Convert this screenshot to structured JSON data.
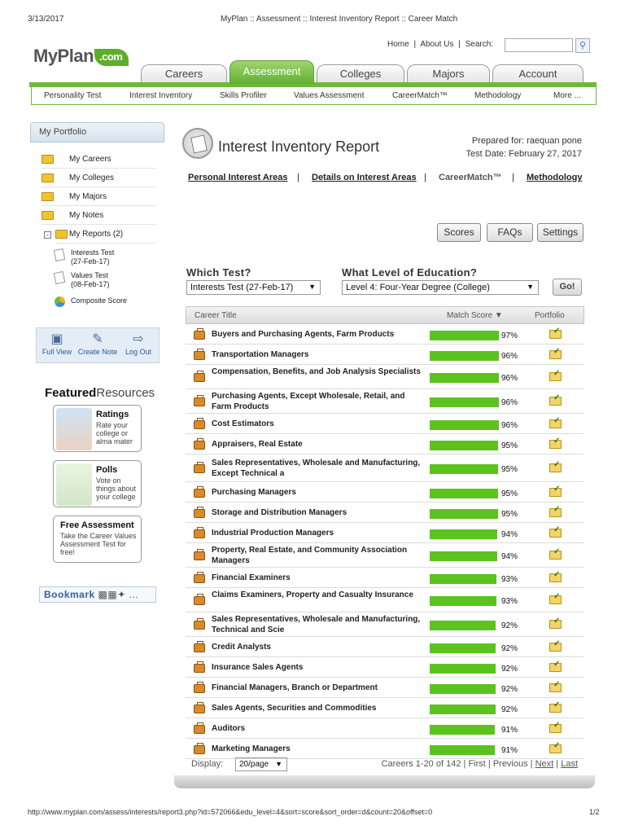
{
  "print": {
    "date": "3/13/2017",
    "title": "MyPlan :: Assessment :: Interest Inventory Report :: Career Match",
    "url": "http://www.myplan.com/assess/interests/report3.php?id=572066&edu_level=4&sort=score&sort_order=d&count=20&offset=0",
    "page": "1/2"
  },
  "header": {
    "logo_main": "MyPlan",
    "logo_com": ".com",
    "home": "Home",
    "about": "About Us",
    "search_label": "Search:",
    "search_value": "",
    "sep": "|"
  },
  "tabs": [
    "Careers",
    "Assessment",
    "Colleges",
    "Majors",
    "Account"
  ],
  "subnav": [
    "Personality Test",
    "Interest Inventory",
    "Skills Profiler",
    "Values Assessment",
    "CareerMatch™",
    "Methodology",
    "More ..."
  ],
  "sidebar": {
    "portfolio_title": "My Portfolio",
    "items": [
      "My Careers",
      "My Colleges",
      "My Majors",
      "My Notes",
      "My Reports (2)"
    ],
    "reports": [
      {
        "line1": "Interests Test",
        "line2": "(27-Feb-17)"
      },
      {
        "line1": "Values Test",
        "line2": "(08-Feb-17)"
      }
    ],
    "composite": "Composite Score",
    "tools": [
      "Full View",
      "Create Note",
      "Log Out"
    ],
    "featured_bold": "Featured",
    "featured_rest": "Resources",
    "resources": [
      {
        "title": "Ratings",
        "text": "Rate your college or alma mater"
      },
      {
        "title": "Polls",
        "text": "Vote on things about your college"
      },
      {
        "title": "Free Assessment",
        "text": "Take the Career Values Assessment Test for free!"
      }
    ],
    "bookmark": "Bookmark"
  },
  "report": {
    "title": "Interest Inventory Report",
    "prepared_for": "Prepared for: raequan pone",
    "test_date": "Test Date: February 27, 2017",
    "links": [
      "Personal Interest Areas",
      "Details on Interest Areas",
      "CareerMatch™",
      "Methodology"
    ],
    "buttons": [
      "Scores",
      "FAQs",
      "Settings"
    ],
    "which_test_label": "Which Test?",
    "which_test_value": "Interests Test (27-Feb-17)",
    "education_label": "What Level of Education?",
    "education_value": "Level 4: Four-Year Degree (College)",
    "go": "Go!"
  },
  "table": {
    "headers": {
      "title": "Career Title",
      "score": "Match Score ▼",
      "portfolio": "Portfolio"
    },
    "rows": [
      {
        "title": "Buyers and Purchasing Agents, Farm Products",
        "score": 97,
        "pct": "97%"
      },
      {
        "title": "Transportation Managers",
        "score": 96,
        "pct": "96%"
      },
      {
        "title": "Compensation, Benefits, and Job Analysis Specialists",
        "score": 96,
        "pct": "96%"
      },
      {
        "title": "Purchasing Agents, Except Wholesale, Retail, and Farm Products",
        "score": 96,
        "pct": "96%"
      },
      {
        "title": "Cost Estimators",
        "score": 96,
        "pct": "96%"
      },
      {
        "title": "Appraisers, Real Estate",
        "score": 95,
        "pct": "95%"
      },
      {
        "title": "Sales Representatives, Wholesale and Manufacturing, Except Technical a",
        "score": 95,
        "pct": "95%"
      },
      {
        "title": "Purchasing Managers",
        "score": 95,
        "pct": "95%"
      },
      {
        "title": "Storage and Distribution Managers",
        "score": 95,
        "pct": "95%"
      },
      {
        "title": "Industrial Production Managers",
        "score": 94,
        "pct": "94%"
      },
      {
        "title": "Property, Real Estate, and Community Association Managers",
        "score": 94,
        "pct": "94%"
      },
      {
        "title": "Financial Examiners",
        "score": 93,
        "pct": "93%"
      },
      {
        "title": "Claims Examiners, Property and Casualty Insurance",
        "score": 93,
        "pct": "93%"
      },
      {
        "title": "Sales Representatives, Wholesale and Manufacturing, Technical and Scie",
        "score": 92,
        "pct": "92%"
      },
      {
        "title": "Credit Analysts",
        "score": 92,
        "pct": "92%"
      },
      {
        "title": "Insurance Sales Agents",
        "score": 92,
        "pct": "92%"
      },
      {
        "title": "Financial Managers, Branch or Department",
        "score": 92,
        "pct": "92%"
      },
      {
        "title": "Sales Agents, Securities and Commodities",
        "score": 92,
        "pct": "92%"
      },
      {
        "title": "Auditors",
        "score": 91,
        "pct": "91%"
      },
      {
        "title": "Marketing Managers",
        "score": 91,
        "pct": "91%"
      }
    ],
    "display_label": "Display:",
    "per_page": "20/page",
    "range": "Careers 1-20 of 142",
    "first": "First",
    "previous": "Previous",
    "next": "Next",
    "last": "Last"
  },
  "colors": {
    "accent_green": "#6cba3c",
    "bar_green": "#5cc21e"
  }
}
